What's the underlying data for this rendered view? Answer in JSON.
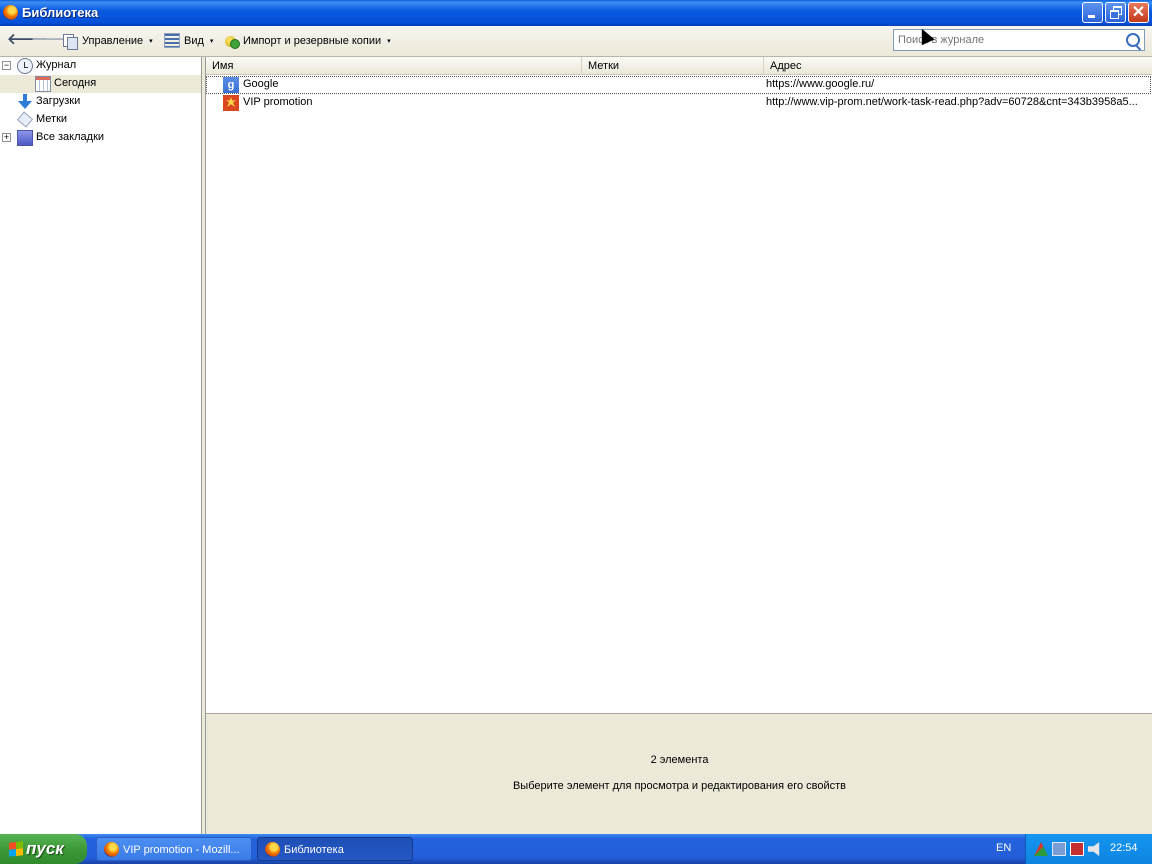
{
  "window": {
    "title": "Библиотека",
    "close_glyph": "✕"
  },
  "toolbar": {
    "back_glyph": "🡐",
    "forward_glyph": "🡒",
    "organize_label": "Управление",
    "view_label": "Вид",
    "import_label": "Импорт и резервные копии",
    "dropdown_glyph": "▾",
    "search_placeholder": "Поиск в журнале"
  },
  "sidebar": {
    "expand_glyph": "+",
    "collapse_glyph": "−",
    "items": [
      {
        "label": "Журнал",
        "icon": "history-clock-icon",
        "expanded": true
      },
      {
        "label": "Сегодня",
        "icon": "calendar-today-icon",
        "selected": true
      },
      {
        "label": "Загрузки",
        "icon": "download-arrow-icon"
      },
      {
        "label": "Метки",
        "icon": "tag-icon"
      },
      {
        "label": "Все закладки",
        "icon": "all-bookmarks-icon",
        "expanded": false
      }
    ]
  },
  "list": {
    "columns": [
      "Имя",
      "Метки",
      "Адрес"
    ],
    "rows": [
      {
        "name": "Google",
        "tags": "",
        "address": "https://www.google.ru/",
        "favicon": "google-favicon",
        "favicon_glyph": "g"
      },
      {
        "name": "VIP promotion",
        "tags": "",
        "address": "http://www.vip-prom.net/work-task-read.php?adv=60728&cnt=343b3958a5...",
        "favicon": "vip-favicon"
      }
    ]
  },
  "details": {
    "count_text": "2 элемента",
    "hint_text": "Выберите элемент для просмотра и редактирования его свойств"
  },
  "taskbar": {
    "start_label": "пуск",
    "buttons": [
      {
        "label": "VIP promotion - Mozill...",
        "active": false
      },
      {
        "label": "Библиотека",
        "active": true
      }
    ],
    "language": "EN",
    "clock": "22:54"
  }
}
